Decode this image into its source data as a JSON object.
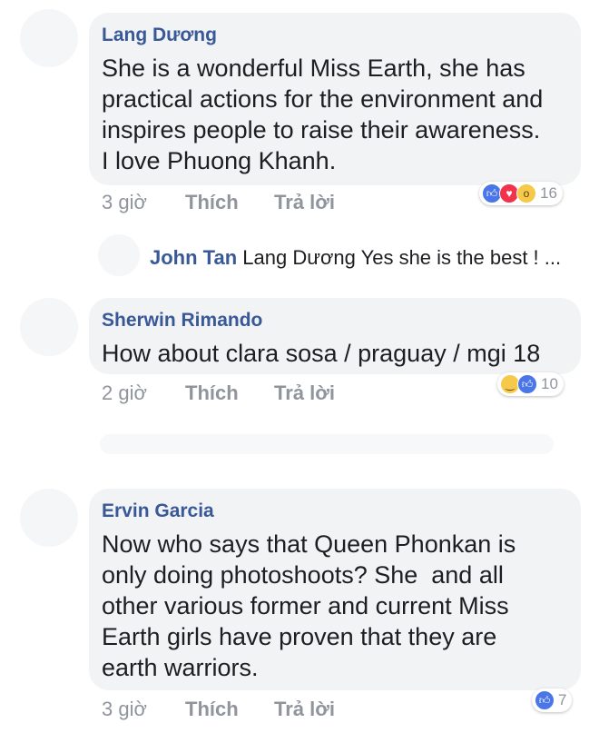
{
  "comments": [
    {
      "author": "Lang Dương",
      "text": "She is a wonderful Miss Earth, she has practical actions for the environment and inspires people to raise their awareness. I love Phuong Khanh.",
      "lines": [
        "She is a wonderful Miss Earth, she has",
        "practical actions for the environment and",
        "inspires people to raise their awareness.",
        "I love Phuong Khanh."
      ],
      "time": "3 giờ",
      "like_label": "Thích",
      "reply_label": "Trả lời",
      "reactions": [
        "like-icon",
        "love-icon",
        "wow-icon"
      ],
      "reaction_count": "16"
    },
    {
      "author": "Sherwin Rimando",
      "lines": [
        "How about clara sosa / praguay / mgi 18"
      ],
      "time": "2 giờ",
      "like_label": "Thích",
      "reply_label": "Trả lời",
      "reactions": [
        "haha-icon",
        "like-icon"
      ],
      "reaction_count": "10"
    },
    {
      "author": "Ervin Garcia",
      "lines": [
        "Now who says that Queen Phonkan is",
        "only doing photoshoots? She  and all",
        "other various former and current Miss",
        "Earth girls have proven that they are",
        "earth warriors."
      ],
      "time": "3 giờ",
      "like_label": "Thích",
      "reply_label": "Trả lời",
      "reactions": [
        "like-icon"
      ],
      "reaction_count": "7"
    }
  ],
  "reply": {
    "author": "John Tan",
    "text": "Lang Dương Yes she is the best ! ..."
  }
}
